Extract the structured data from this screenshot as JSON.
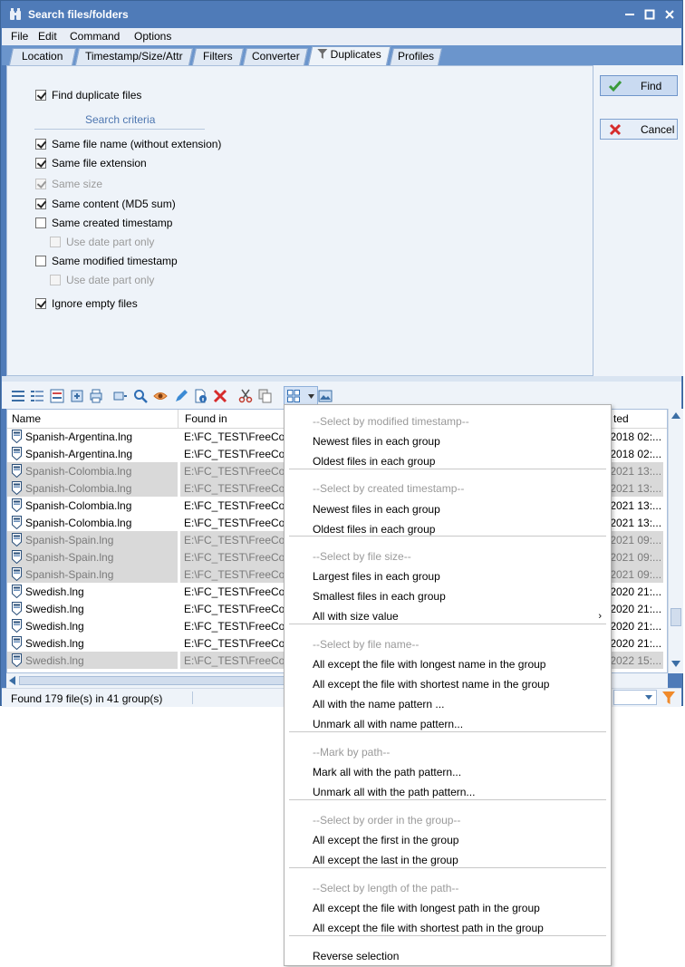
{
  "window": {
    "title": "Search files/folders"
  },
  "menu_bar": [
    "File",
    "Edit",
    "Command",
    "Options"
  ],
  "tabs": [
    "Location",
    "Timestamp/Size/Attr",
    "Filters",
    "Converter",
    "Duplicates",
    "Profiles"
  ],
  "active_tab": "Duplicates",
  "duplicates": {
    "find_duplicates": {
      "label": "Find duplicate files",
      "checked": true
    },
    "criteria_label": "Search criteria",
    "options": [
      {
        "label": "Same file name (without extension)",
        "checked": true,
        "disabled": false,
        "indent": false
      },
      {
        "label": "Same file extension",
        "checked": true,
        "disabled": false,
        "indent": false
      },
      {
        "label": "Same size",
        "checked": true,
        "disabled": true,
        "indent": false
      },
      {
        "label": "Same content (MD5 sum)",
        "checked": true,
        "disabled": false,
        "indent": false
      },
      {
        "label": "Same created timestamp",
        "checked": false,
        "disabled": false,
        "indent": false
      },
      {
        "label": "Use date part only",
        "checked": false,
        "disabled": true,
        "indent": true
      },
      {
        "label": "Same modified timestamp",
        "checked": false,
        "disabled": false,
        "indent": false
      },
      {
        "label": "Use date part only",
        "checked": false,
        "disabled": true,
        "indent": true
      },
      {
        "label": "Ignore empty files",
        "checked": true,
        "disabled": false,
        "indent": false
      }
    ]
  },
  "buttons": {
    "find": "Find",
    "cancel": "Cancel"
  },
  "list": {
    "columns": [
      "Name",
      "Found in",
      "ted"
    ],
    "rows": [
      {
        "name": "Spanish-Argentina.lng",
        "path": "E:\\FC_TEST\\FreeCom",
        "date": ".2018 02:...",
        "marked": false
      },
      {
        "name": "Spanish-Argentina.lng",
        "path": "E:\\FC_TEST\\FreeCom",
        "date": ".2018 02:...",
        "marked": false
      },
      {
        "name": "Spanish-Colombia.lng",
        "path": "E:\\FC_TEST\\FreeCom",
        "date": ".2021 13:...",
        "marked": true
      },
      {
        "name": "Spanish-Colombia.lng",
        "path": "E:\\FC_TEST\\FreeCom",
        "date": ".2021 13:...",
        "marked": true
      },
      {
        "name": "Spanish-Colombia.lng",
        "path": "E:\\FC_TEST\\FreeCom",
        "date": ".2021 13:...",
        "marked": false
      },
      {
        "name": "Spanish-Colombia.lng",
        "path": "E:\\FC_TEST\\FreeCom",
        "date": ".2021 13:...",
        "marked": false
      },
      {
        "name": "Spanish-Spain.lng",
        "path": "E:\\FC_TEST\\FreeCom",
        "date": ".2021 09:...",
        "marked": true
      },
      {
        "name": "Spanish-Spain.lng",
        "path": "E:\\FC_TEST\\FreeCom",
        "date": ".2021 09:...",
        "marked": true
      },
      {
        "name": "Spanish-Spain.lng",
        "path": "E:\\FC_TEST\\FreeCom",
        "date": ".2021 09:...",
        "marked": true
      },
      {
        "name": "Swedish.lng",
        "path": "E:\\FC_TEST\\FreeCom",
        "date": ".2020 21:...",
        "marked": false
      },
      {
        "name": "Swedish.lng",
        "path": "E:\\FC_TEST\\FreeCom",
        "date": ".2020 21:...",
        "marked": false
      },
      {
        "name": "Swedish.lng",
        "path": "E:\\FC_TEST\\FreeCom",
        "date": ".2020 21:...",
        "marked": false
      },
      {
        "name": "Swedish.lng",
        "path": "E:\\FC_TEST\\FreeCom",
        "date": ".2020 21:...",
        "marked": false
      },
      {
        "name": "Swedish.lng",
        "path": "E:\\FC_TEST\\FreeCom",
        "date": ".2022 15:...",
        "marked": true
      }
    ]
  },
  "status": {
    "text": "Found 179 file(s) in 41 group(s)"
  },
  "context_menu": [
    {
      "type": "header",
      "label": "--Select by modified timestamp--"
    },
    {
      "type": "item",
      "label": "Newest files in each group"
    },
    {
      "type": "item",
      "label": "Oldest files in each group"
    },
    {
      "type": "sep"
    },
    {
      "type": "header",
      "label": "--Select by created timestamp--"
    },
    {
      "type": "item",
      "label": "Newest files in each group"
    },
    {
      "type": "item",
      "label": "Oldest files in each group"
    },
    {
      "type": "sep"
    },
    {
      "type": "header",
      "label": "--Select by file size--"
    },
    {
      "type": "item",
      "label": "Largest files in each group"
    },
    {
      "type": "item",
      "label": "Smallest files in each group"
    },
    {
      "type": "item",
      "label": "All with size value",
      "submenu": true
    },
    {
      "type": "sep"
    },
    {
      "type": "header",
      "label": "--Select by file name--"
    },
    {
      "type": "item",
      "label": "All except the file with longest name in the group"
    },
    {
      "type": "item",
      "label": "All except the file with shortest name in the group"
    },
    {
      "type": "item",
      "label": "All with the name pattern ..."
    },
    {
      "type": "item",
      "label": "Unmark all with name pattern..."
    },
    {
      "type": "sep"
    },
    {
      "type": "header",
      "label": "--Mark by path--"
    },
    {
      "type": "item",
      "label": "Mark all with the path pattern..."
    },
    {
      "type": "item",
      "label": "Unmark all with the path pattern..."
    },
    {
      "type": "sep"
    },
    {
      "type": "header",
      "label": "--Select by order in the group--"
    },
    {
      "type": "item",
      "label": "All except the first in the group"
    },
    {
      "type": "item",
      "label": "All except the last in the group"
    },
    {
      "type": "sep"
    },
    {
      "type": "header",
      "label": "--Select by length of the path--"
    },
    {
      "type": "item",
      "label": "All except the file with longest path in the group"
    },
    {
      "type": "item",
      "label": "All except the file with shortest path in the group"
    },
    {
      "type": "sep"
    },
    {
      "type": "item",
      "label": "Reverse selection"
    }
  ],
  "colors": {
    "title_bar": "#4f7bb8",
    "panel": "#eef3f9",
    "marked_row": "#d9d9d9",
    "accent": "#4d76b0"
  }
}
